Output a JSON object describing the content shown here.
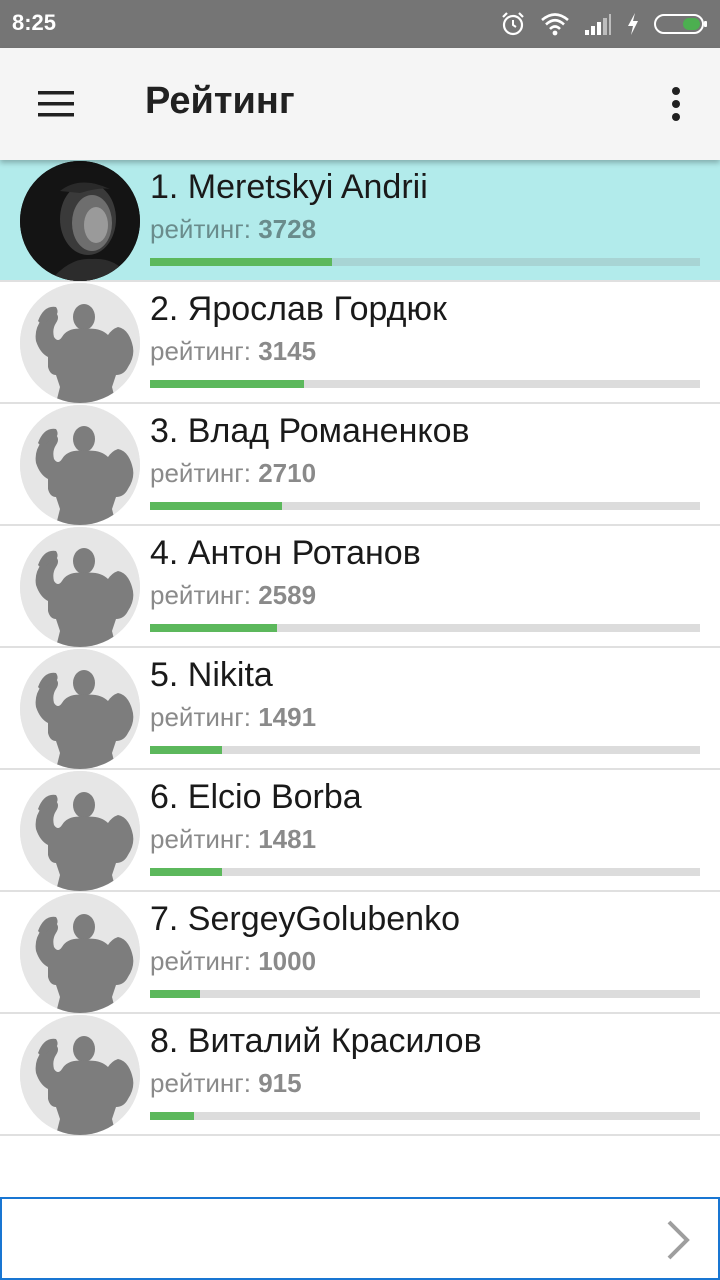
{
  "status_bar": {
    "time": "8:25",
    "icons": [
      "alarm-icon",
      "wifi-icon",
      "signal-icon",
      "charging-icon",
      "battery-icon"
    ]
  },
  "app_bar": {
    "title": "Рейтинг",
    "menu_icon": "hamburger-menu-icon",
    "overflow_icon": "more-vert-icon"
  },
  "rating_label": "рейтинг:",
  "colors": {
    "highlight": "#b2ebeb",
    "progress": "#5cb85c",
    "track": "#dcdcdc"
  },
  "players": [
    {
      "name": "1. Meretskyi Andrii",
      "rating": "3728",
      "progress": 0.33,
      "highlight": true,
      "avatar": "photo"
    },
    {
      "name": "2. Ярослав Гордюк",
      "rating": "3145",
      "progress": 0.28,
      "highlight": false,
      "avatar": "bodybuilder-placeholder"
    },
    {
      "name": "3. Влад Романенков",
      "rating": "2710",
      "progress": 0.24,
      "highlight": false,
      "avatar": "bodybuilder-placeholder"
    },
    {
      "name": "4. Антон Ротанов",
      "rating": "2589",
      "progress": 0.23,
      "highlight": false,
      "avatar": "bodybuilder-placeholder"
    },
    {
      "name": "5. Nikita",
      "rating": "1491",
      "progress": 0.13,
      "highlight": false,
      "avatar": "bodybuilder-placeholder"
    },
    {
      "name": "6. Elcio Borba",
      "rating": "1481",
      "progress": 0.13,
      "highlight": false,
      "avatar": "bodybuilder-placeholder"
    },
    {
      "name": "7. SergeyGolubenko",
      "rating": "1000",
      "progress": 0.09,
      "highlight": false,
      "avatar": "bodybuilder-placeholder"
    },
    {
      "name": "8. Виталий Красилов",
      "rating": "915",
      "progress": 0.08,
      "highlight": false,
      "avatar": "bodybuilder-placeholder"
    }
  ],
  "bottom": {
    "next_icon": "chevron-right-icon"
  }
}
